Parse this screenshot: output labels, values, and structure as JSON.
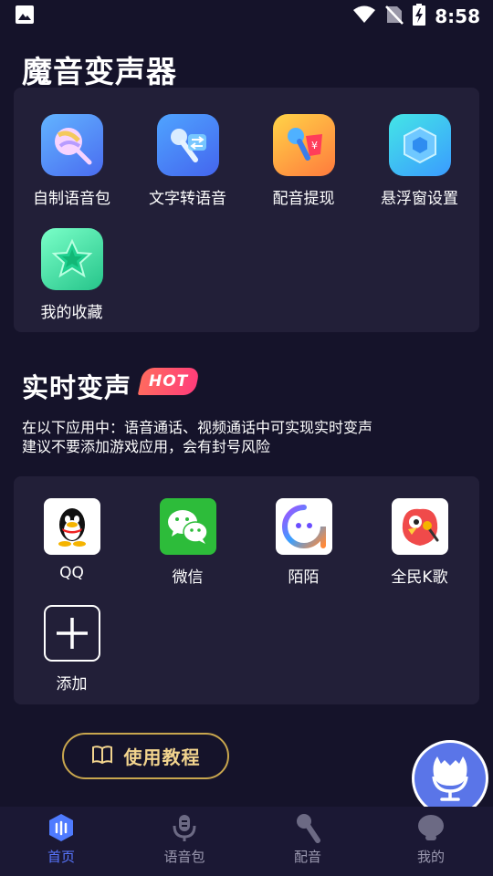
{
  "status_bar": {
    "time": "8:58"
  },
  "app_title": "魔音变声器",
  "tools": [
    {
      "label": "自制语音包",
      "icon": "lollipop-icon"
    },
    {
      "label": "文字转语音",
      "icon": "microphone-transfer-icon"
    },
    {
      "label": "配音提现",
      "icon": "mic-cash-icon"
    },
    {
      "label": "悬浮窗设置",
      "icon": "hexagon-icon"
    },
    {
      "label": "我的收藏",
      "icon": "star-icon"
    }
  ],
  "realtime": {
    "title": "实时变声",
    "badge": "HOT",
    "desc_line1": "在以下应用中：语音通话、视频通话中可实现实时变声",
    "desc_line2": "建议不要添加游戏应用，会有封号风险"
  },
  "apps": [
    {
      "label": "QQ",
      "icon": "qq-penguin-icon"
    },
    {
      "label": "微信",
      "icon": "wechat-icon"
    },
    {
      "label": "陌陌",
      "icon": "momo-icon"
    },
    {
      "label": "全民K歌",
      "icon": "kge-bird-icon"
    },
    {
      "label": "添加",
      "icon": "plus-icon"
    }
  ],
  "tutorial_button": "使用教程",
  "nav": [
    {
      "label": "首页",
      "active": true
    },
    {
      "label": "语音包",
      "active": false
    },
    {
      "label": "配音",
      "active": false
    },
    {
      "label": "我的",
      "active": false
    }
  ],
  "colors": {
    "background": "#15132a",
    "panel": "#221f38",
    "accent_blue": "#5876ff",
    "gold": "#c8a64e",
    "hot_red": "#ff4d6d"
  }
}
